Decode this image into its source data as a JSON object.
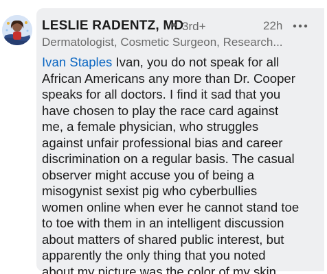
{
  "comment": {
    "author_name": "LESLIE RADENTZ, MD",
    "separator": "•",
    "connection_degree": "3rd+",
    "timestamp": "22h",
    "more_icon": "ellipsis-icon",
    "headline": "Dermatologist, Cosmetic Surgeon, Research...",
    "mention": "Ivan Staples",
    "body_lines": [
      " Ivan, you do not speak for all",
      "African Americans any more than Dr. Cooper",
      "speaks for all doctors. I find it sad that you",
      "have chosen to play the race card against",
      "me, a female physician, who struggles",
      "against unfair professional bias and career",
      "discrimination on a regular basis. The casual",
      "observer might accuse you of being a",
      "misogynist sexist pig who cyberbullies",
      "women online when ever he cannot stand toe",
      "to toe with them in  an intelligent discussion",
      "about matters of shared public interest, but",
      "apparently the only thing that you noted",
      "about my picture was the color of my skin."
    ]
  },
  "colors": {
    "bubble_bg": "#eeeff1",
    "mention": "#0a66c2",
    "text": "#1b1b1b",
    "muted": "#6b6b6b"
  }
}
